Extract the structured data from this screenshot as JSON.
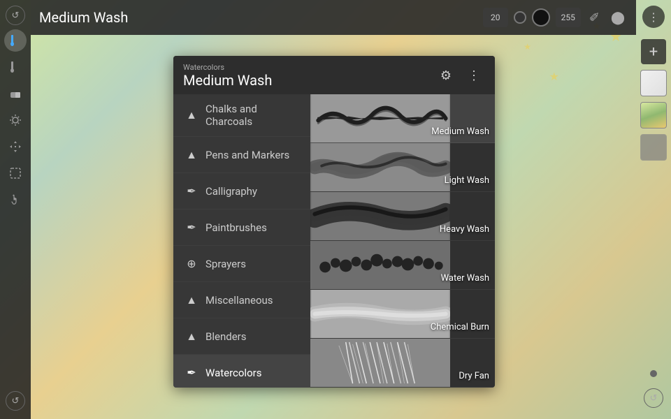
{
  "background": {
    "color": "#c8d8a0"
  },
  "topbar": {
    "title": "Medium Wash",
    "size_small": "20",
    "size_large": "255"
  },
  "brushPanel": {
    "subtitle": "Watercolors",
    "title": "Medium Wash",
    "settings_icon": "⚙",
    "more_icon": "⋮"
  },
  "categories": [
    {
      "id": "chalks",
      "label": "Chalks and Charcoals",
      "icon": "▲"
    },
    {
      "id": "pens",
      "label": "Pens and Markers",
      "icon": "▲"
    },
    {
      "id": "calligraphy",
      "label": "Calligraphy",
      "icon": "✒"
    },
    {
      "id": "paintbrushes",
      "label": "Paintbrushes",
      "icon": "✒"
    },
    {
      "id": "sprayers",
      "label": "Sprayers",
      "icon": "⊕"
    },
    {
      "id": "misc",
      "label": "Miscellaneous",
      "icon": "▲"
    },
    {
      "id": "blenders",
      "label": "Blenders",
      "icon": "▲"
    },
    {
      "id": "watercolors",
      "label": "Watercolors",
      "icon": "✒",
      "active": true
    }
  ],
  "brushes": [
    {
      "id": "medium-wash",
      "name": "Medium Wash",
      "active": true
    },
    {
      "id": "light-wash",
      "name": "Light Wash"
    },
    {
      "id": "heavy-wash",
      "name": "Heavy Wash"
    },
    {
      "id": "water-wash",
      "name": "Water Wash"
    },
    {
      "id": "chemical-burn",
      "name": "Chemical Burn"
    },
    {
      "id": "dry-fan",
      "name": "Dry Fan"
    }
  ],
  "toolbar": {
    "undo_icon": "↺",
    "brush_icon": "🖌",
    "smudge_icon": "◈",
    "eraser_icon": "◻",
    "selection_icon": "⊹",
    "move_icon": "✛",
    "lasso_icon": "⬡",
    "gesture_icon": "✋",
    "adjust_icon": "⊞"
  },
  "rightPanel": {
    "more_icon": "⋮",
    "add_icon": "+",
    "undo_icon": "↺"
  }
}
